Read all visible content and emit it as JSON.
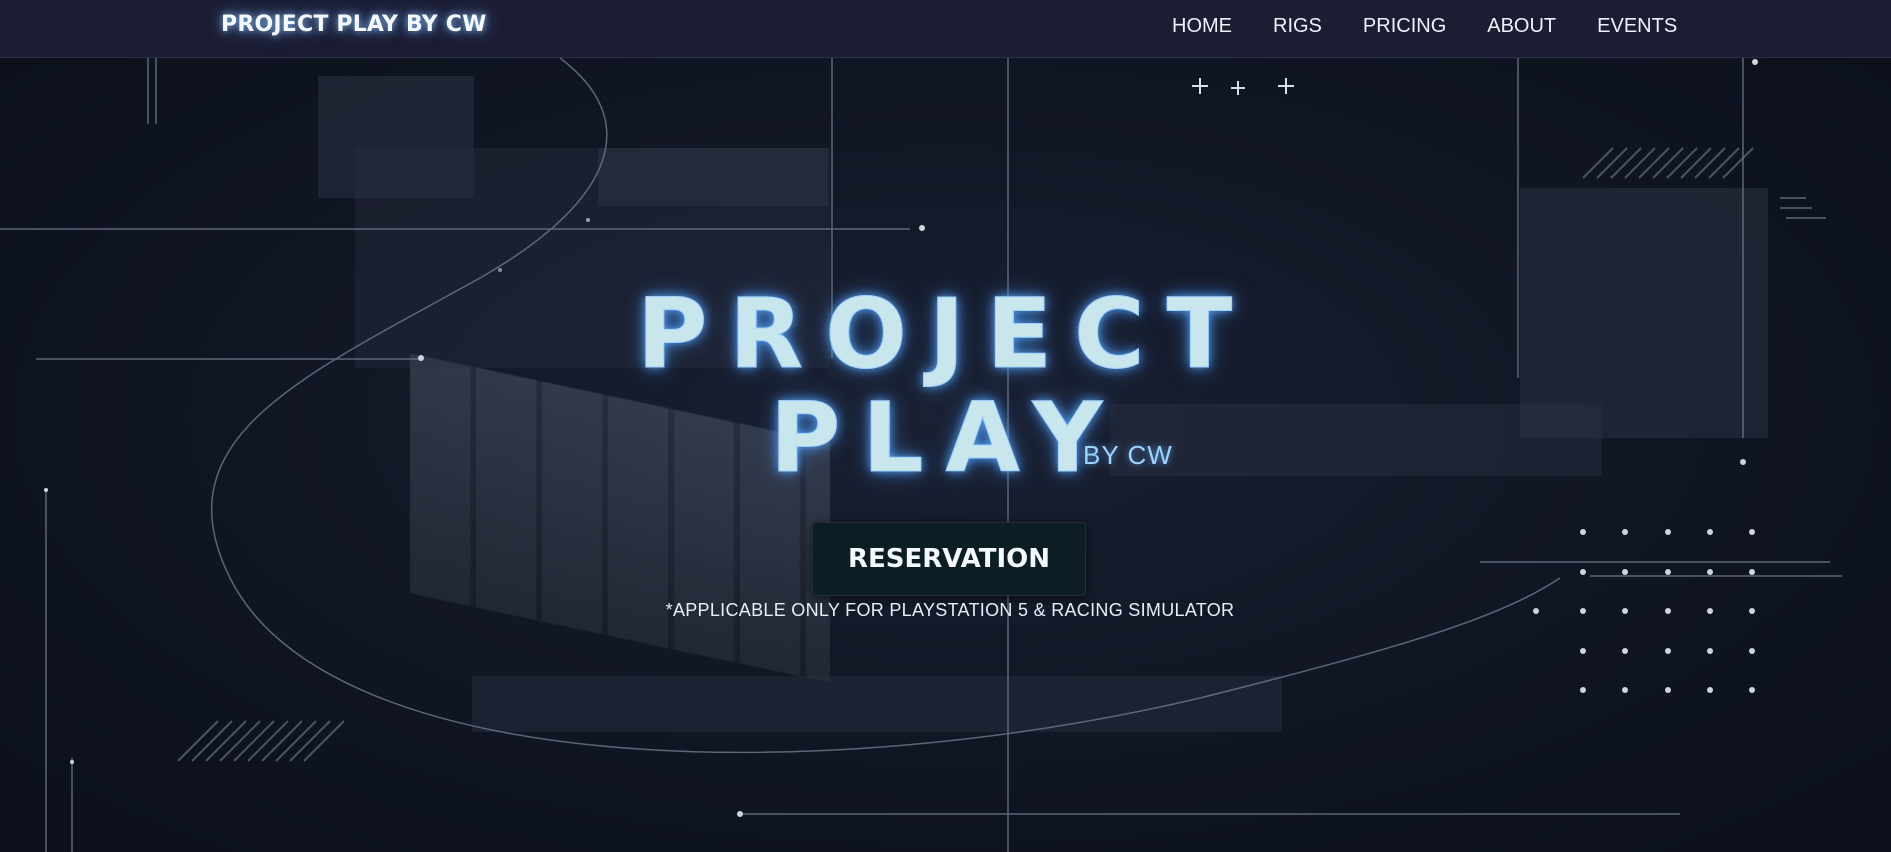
{
  "nav": {
    "brand": "PROJECT PLAY BY CW",
    "links": [
      {
        "label": "HOME"
      },
      {
        "label": "RIGS"
      },
      {
        "label": "PRICING"
      },
      {
        "label": "ABOUT"
      },
      {
        "label": "EVENTS"
      }
    ]
  },
  "hero": {
    "title_line1": "PROJECT",
    "title_line2": "PLAY",
    "title_suffix": "BY CW",
    "reserve_label": "RESERVATION",
    "note": "*APPLICABLE ONLY FOR PLAYSTATION 5 & RACING SIMULATOR"
  },
  "colors": {
    "nav_bg": "#1c1c33",
    "hero_bg": "#121726",
    "title_glow": "#5aaaff",
    "button_bg": "#0c1d24"
  }
}
